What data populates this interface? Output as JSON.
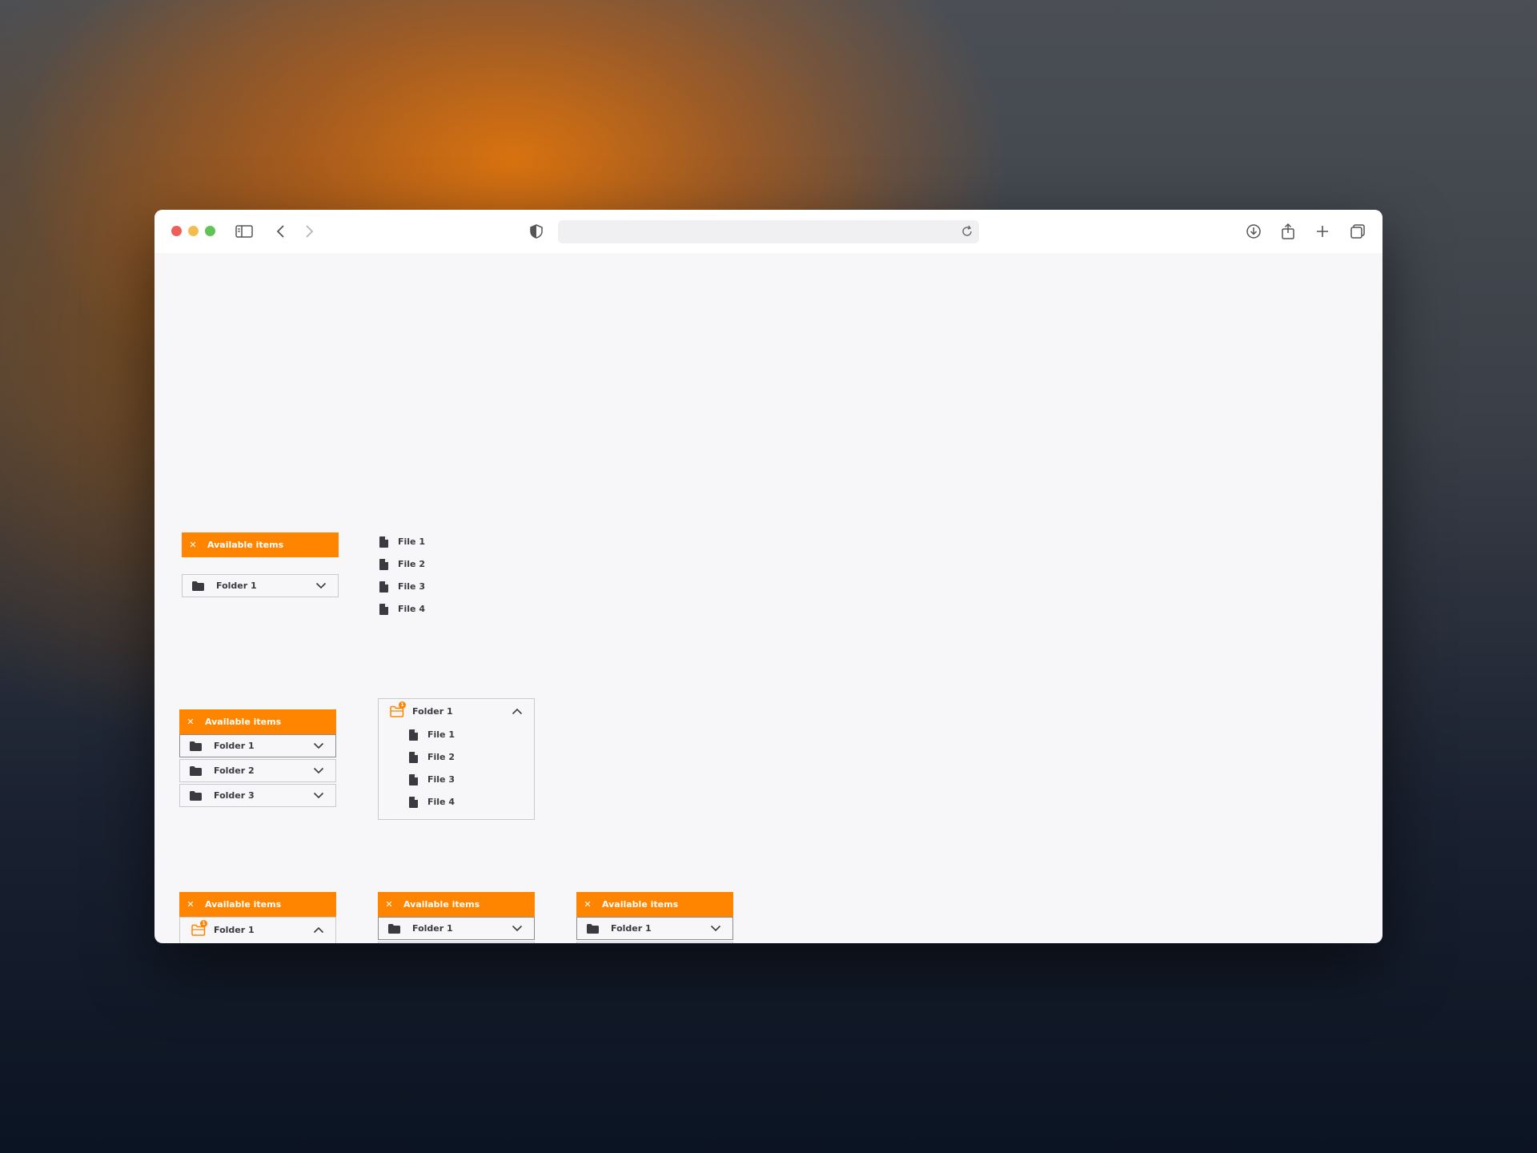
{
  "header_title": "Available items",
  "close_glyph": "✕",
  "folders": [
    "Folder 1",
    "Folder 2",
    "Folder 3"
  ],
  "files": [
    "File 1",
    "File 2",
    "File 3",
    "File 4"
  ],
  "badge_count": "1",
  "colors": {
    "accent": "#ff8500",
    "icon": "#3a3a40",
    "border": "#c9c9cf"
  },
  "icons": [
    "sidebar-icon",
    "back-icon",
    "forward-icon",
    "shield-icon",
    "reload-icon",
    "download-icon",
    "share-icon",
    "plus-icon",
    "tabs-icon",
    "folder-icon",
    "folder-open-icon",
    "file-icon",
    "chevron-down-icon",
    "chevron-up-icon",
    "close-icon"
  ]
}
